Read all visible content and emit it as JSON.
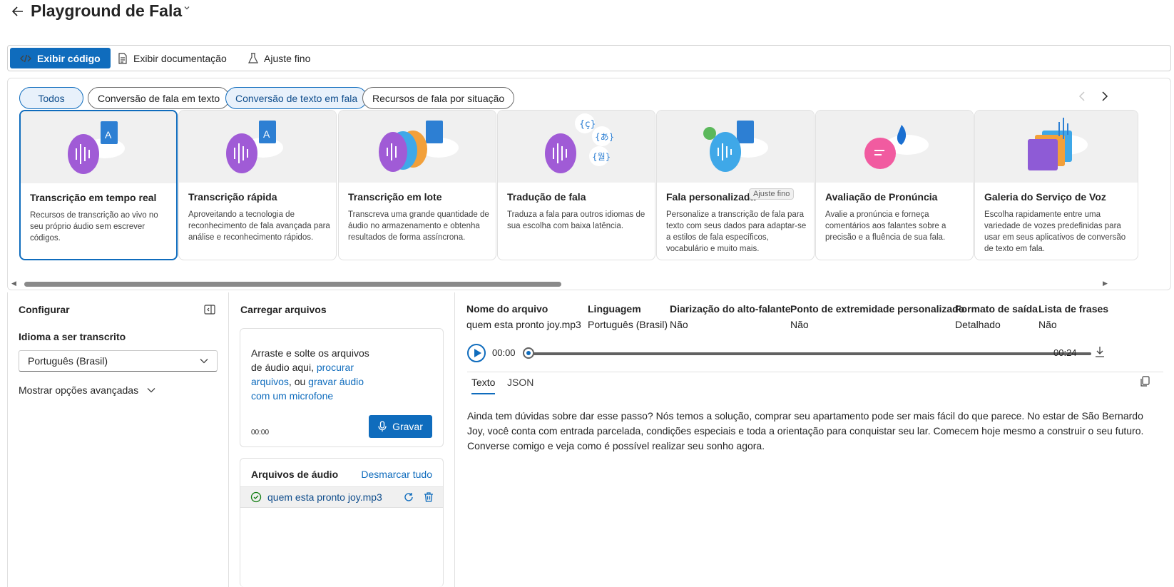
{
  "header": {
    "title": "Playground de Fala"
  },
  "toolbar": {
    "view_code": "Exibir código",
    "view_docs": "Exibir documentação",
    "fine_tune": "Ajuste fino"
  },
  "filters": [
    "Todos",
    "Conversão de fala em texto",
    "Conversão de texto em fala",
    "Recursos de fala por situação"
  ],
  "cards": [
    {
      "title": "Transcrição em tempo real",
      "desc": "Recursos de transcrição ao vivo no seu próprio áudio sem escrever códigos."
    },
    {
      "title": "Transcrição rápida",
      "desc": "Aproveitando a tecnologia de reconhecimento de fala avançada para análise e reconhecimento rápidos."
    },
    {
      "title": "Transcrição em lote",
      "desc": "Transcreva uma grande quantidade de áudio no armazenamento e obtenha resultados de forma assíncrona."
    },
    {
      "title": "Tradução de fala",
      "desc": "Traduza a fala para outros idiomas de sua escolha com baixa latência."
    },
    {
      "title": "Fala personalizada",
      "badge": "Ajuste fino",
      "desc": "Personalize a transcrição de fala para texto com seus dados para adaptar-se a estilos de fala específicos, vocabulário e muito mais."
    },
    {
      "title": "Avaliação de Pronúncia",
      "desc": "Avalie a pronúncia e forneça comentários aos falantes sobre a precisão e a fluência de sua fala."
    },
    {
      "title": "Galeria do Serviço de Voz",
      "desc": "Escolha rapidamente entre uma variedade de vozes predefinidas para usar em seus aplicativos de conversão de texto em fala."
    }
  ],
  "configure": {
    "title": "Configurar",
    "lang_label": "Idioma a ser transcrito",
    "lang_value": "Português (Brasil)",
    "advanced": "Mostrar opções avançadas"
  },
  "upload": {
    "title": "Carregar arquivos",
    "drop_text": "Arraste e solte os arquivos de áudio aqui,",
    "browse": "procurar arquivos",
    "or": ", ou",
    "record_link": "gravar áudio com um microfone",
    "time": "00:00",
    "record_button": "Gravar",
    "files_title": "Arquivos de áudio",
    "unmark_all": "Desmarcar tudo",
    "file": "quem esta pronto joy.mp3"
  },
  "result": {
    "meta": [
      {
        "k": "Nome do arquivo",
        "v": "quem esta pronto joy.mp3"
      },
      {
        "k": "Linguagem",
        "v": "Português (Brasil)"
      },
      {
        "k": "Diarização do alto-falante",
        "v": "Não"
      },
      {
        "k": "Ponto de extremidade personalizado",
        "v": "Não"
      },
      {
        "k": "Formato de saída",
        "v": "Detalhado"
      },
      {
        "k": "Lista de frases",
        "v": "Não"
      }
    ],
    "time_start": "00:00",
    "time_end": "00:24",
    "tab_text": "Texto",
    "tab_json": "JSON",
    "transcript": "Ainda tem dúvidas sobre dar esse passo? Nós temos a solução, comprar seu apartamento pode ser mais fácil do que parece. No estar de São Bernardo Joy, você conta com entrada parcelada, condições especiais e toda a orientação para conquistar seu lar. Comecem hoje mesmo a construir o seu futuro. Converse comigo e veja como é possível realizar seu sonho agora."
  }
}
